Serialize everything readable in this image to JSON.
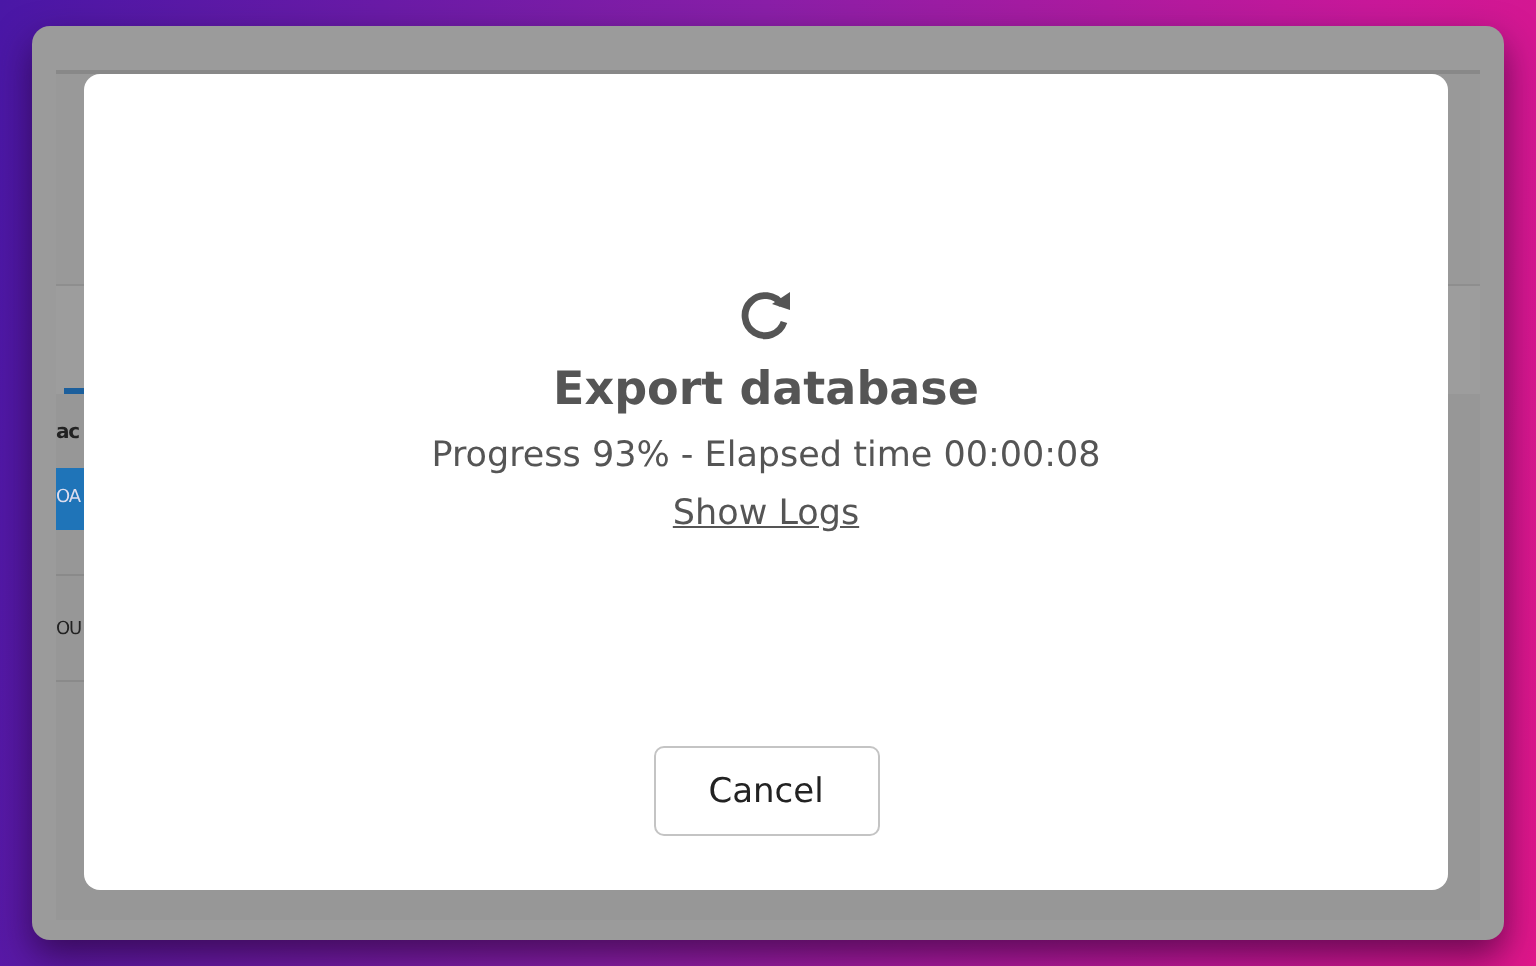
{
  "background_app": {
    "fragments": [
      {
        "kind": "heading",
        "text": "ac"
      },
      {
        "kind": "button",
        "text": "OA"
      },
      {
        "kind": "label",
        "text": "OU"
      }
    ]
  },
  "dialog": {
    "title": "Export database",
    "status": "Progress 93% - Elapsed time 00:00:08",
    "link": "Show Logs",
    "buttons": [
      "Cancel"
    ]
  }
}
